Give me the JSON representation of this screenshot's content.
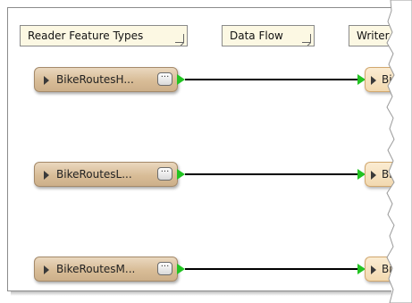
{
  "headers": {
    "reader_label": "Reader Feature Types",
    "dataflow_label": "Data Flow",
    "writer_label": "Writer F"
  },
  "readers": [
    {
      "label": "BikeRoutesH...",
      "more": "···"
    },
    {
      "label": "BikeRoutesL...",
      "more": "···"
    },
    {
      "label": "BikeRoutesM...",
      "more": "···"
    }
  ],
  "writers": [
    {
      "label": "Bi"
    },
    {
      "label": "Bi"
    },
    {
      "label": "Bi"
    }
  ],
  "colors": {
    "reader_node": "#d8bc97",
    "writer_node": "#f2d9b0",
    "port": "#22c422",
    "connector": "#000000",
    "header_bg": "#fcf8e3"
  }
}
